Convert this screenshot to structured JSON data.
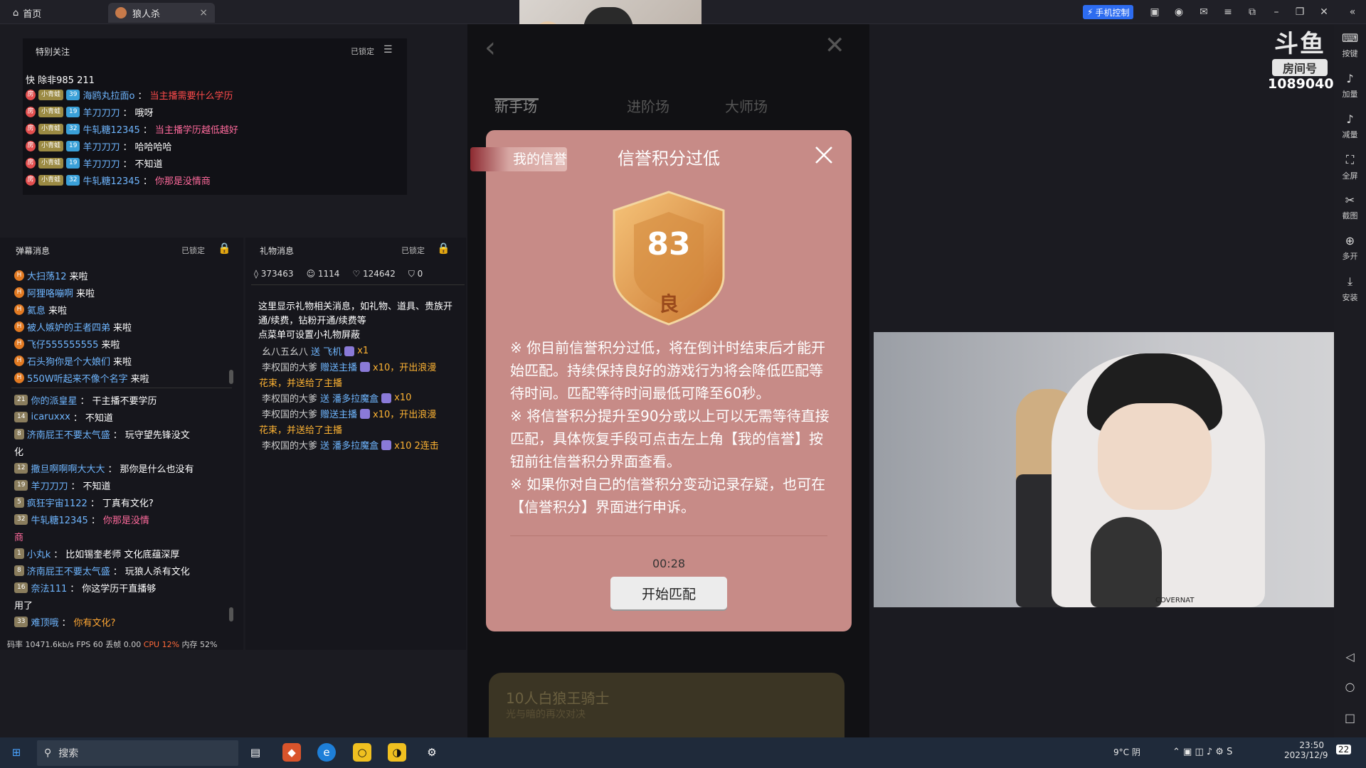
{
  "tabs": {
    "home": "首页",
    "game": "狼人杀"
  },
  "topbar": {
    "phone_control": "手机控制"
  },
  "logo": {
    "brand": "斗鱼",
    "room_label": "房间号",
    "room_no": "1089040"
  },
  "special": {
    "title": "特别关注",
    "lock": "已锁定",
    "first_line": "快  除非985 211",
    "lines": [
      {
        "lvl1": "22",
        "lvl2": "39",
        "user": "海鸥丸拉面o",
        "msg": "当主播需要什么学历",
        "msgcolor": "red"
      },
      {
        "lvl1": "",
        "lvl2": "19",
        "user": "羊刀刀刀",
        "msg": "哦呀",
        "msgcolor": "white"
      },
      {
        "lvl1": "",
        "lvl2": "32",
        "user": "牛轧糖12345",
        "msg": "当主播学历越低越好",
        "msgcolor": "pink"
      },
      {
        "lvl1": "",
        "lvl2": "19",
        "user": "羊刀刀刀",
        "msg": "哈哈哈哈",
        "msgcolor": "white"
      },
      {
        "lvl1": "",
        "lvl2": "19",
        "user": "羊刀刀刀",
        "msg": "不知道",
        "msgcolor": "white"
      },
      {
        "lvl1": "",
        "lvl2": "32",
        "user": "牛轧糖12345",
        "msg": "你那是没情商",
        "msgcolor": "pink"
      }
    ]
  },
  "danmu": {
    "title": "弹幕消息",
    "lock": "已锁定",
    "enters": [
      {
        "user": "大扫荡12",
        "msg": "来啦"
      },
      {
        "user": "阿狸咯嘣啊",
        "msg": "来啦"
      },
      {
        "user": "氦息",
        "msg": "来啦"
      },
      {
        "user": "被人嫉妒的王者四弟",
        "msg": "来啦"
      },
      {
        "user": "飞仔555555555",
        "msg": "来啦"
      },
      {
        "user": "石头狗你是个大娘们",
        "msg": "来啦"
      },
      {
        "user": "550W听起来不像个名字",
        "msg": "来啦"
      }
    ],
    "chats": [
      {
        "lvl": "21",
        "user": "你的派皇星",
        "msg": "干主播不要学历"
      },
      {
        "lvl": "14",
        "user": "icaruxxx",
        "msg": "不知道"
      },
      {
        "lvl": "8",
        "user": "济南屁王不要太气盛",
        "msg": "玩守望先锋没文"
      },
      {
        "lvl": "",
        "user": "",
        "msg": "化"
      },
      {
        "lvl": "12",
        "user": "撒旦啊啊啊大大大",
        "msg": "那你是什么也没有"
      },
      {
        "lvl": "19",
        "user": "羊刀刀刀",
        "msg": "不知道"
      },
      {
        "lvl": "5",
        "user": "疯狂宇宙1122",
        "msg": "丁真有文化?"
      },
      {
        "lvl": "32",
        "user": "牛轧糖12345",
        "msg": "你那是没情"
      },
      {
        "lvl": "",
        "user": "",
        "msg": "商"
      },
      {
        "lvl": "1",
        "user": "小丸k",
        "msg": "比如锡奎老师 文化底蕴深厚"
      },
      {
        "lvl": "8",
        "user": "济南屁王不要太气盛",
        "msg": "玩狼人杀有文化"
      },
      {
        "lvl": "16",
        "user": "奈法111",
        "msg": "你这学历干直播够"
      },
      {
        "lvl": "",
        "user": "",
        "msg": "用了"
      },
      {
        "lvl": "33",
        "user": "难顶哦",
        "msg": "你有文化?"
      }
    ]
  },
  "gift": {
    "title": "礼物消息",
    "lock": "已锁定",
    "stats": {
      "hot": "373463",
      "viewers": "1114",
      "likes": "124642",
      "baskets": "0"
    },
    "intro": "这里显示礼物相关消息，如礼物、道具、贵族开通/续费，钻粉开通/续费等",
    "intro2": "点菜单可设置小礼物屏蔽",
    "lines": [
      {
        "user": "幺八五幺八",
        "act": "送 飞机",
        "count": "x1"
      },
      {
        "user": "李权国的大爹",
        "act": "赠送主播",
        "count": "x10，开出浪漫",
        "extra": "花束，并送给了主播"
      },
      {
        "user": "李权国的大爹",
        "act": "送 潘多拉魔盒",
        "count": "x10"
      },
      {
        "user": "李权国的大爹",
        "act": "赠送主播",
        "count": "x10，开出浪漫",
        "extra": "花束，并送给了主播"
      },
      {
        "user": "李权国的大爹",
        "act": "送 潘多拉魔盒",
        "count": "x10 2连击"
      }
    ]
  },
  "status": {
    "bitrate": "码率 10471.6kb/s",
    "fps": "FPS 60",
    "drop": "丢帧 0.00",
    "cpu": "CPU 12%",
    "mem": "内存 52%"
  },
  "game": {
    "tabs": [
      "新手场",
      "",
      "进阶场",
      "大师场"
    ],
    "bottom_title": "10人白狼王骑士",
    "bottom_sub": "光与暗的再次对决"
  },
  "modal": {
    "my_credit": "我的信誉",
    "title": "信誉积分过低",
    "score": "83",
    "grade": "良",
    "text1": "※ 你目前信誉积分过低，将在倒计时结束后才能开始匹配。持续保持良好的游戏行为将会降低匹配等待时间。匹配等待时间最低可降至60秒。",
    "text2": "※ 将信誉积分提升至90分或以上可以无需等待直接匹配，具体恢复手段可点击左上角【我的信誉】按钮前往信誉积分界面查看。",
    "text3": "※ 如果你对自己的信誉积分变动记录存疑，也可在【信誉积分】界面进行申诉。",
    "timer": "00:28",
    "start": "开始匹配"
  },
  "rightbar": [
    "按键",
    "加量",
    "减量",
    "全屏",
    "截图",
    "多开",
    "安装"
  ],
  "cam_brand": "COVERNAT",
  "taskbar": {
    "search": "搜索",
    "weather": "9°C 阴",
    "time": "23:50",
    "date": "2023/12/9",
    "notif": "22"
  },
  "colors": {
    "modal_bg": "#c78b87",
    "accent_blue": "#2d6cf0",
    "shield_gold": "#e0a04a"
  }
}
